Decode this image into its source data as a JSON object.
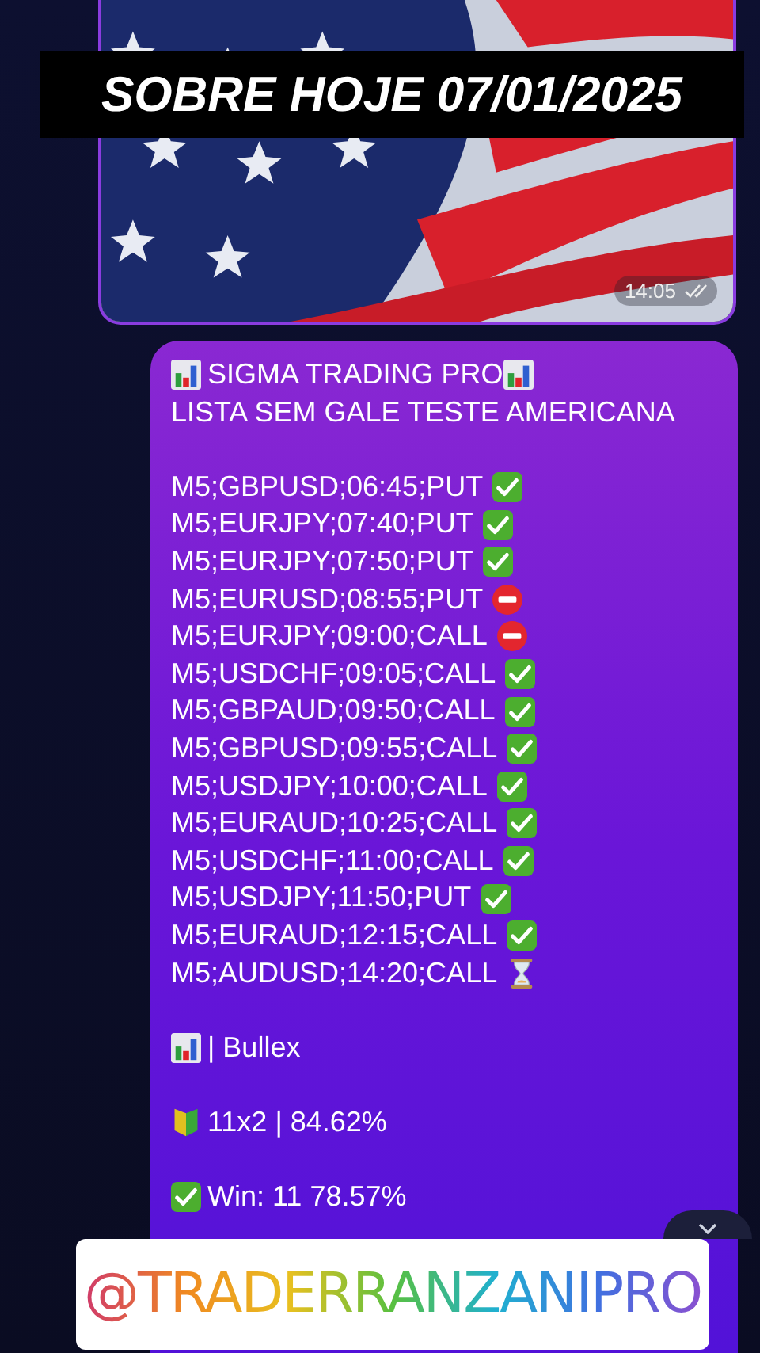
{
  "overlay_caption": "SOBRE HOJE 07/01/2025",
  "photo_message": {
    "kind": "picture",
    "time": "14:05",
    "read": true
  },
  "message": {
    "header": "SIGMA TRADING PRO",
    "subtitle": "LISTA SEM GALE TESTE AMERICANA",
    "signals": [
      {
        "text": "M5;GBPUSD;06:45;PUT",
        "kind": "win"
      },
      {
        "text": "M5;EURJPY;07:40;PUT",
        "kind": "win"
      },
      {
        "text": "M5;EURJPY;07:50;PUT",
        "kind": "win"
      },
      {
        "text": "M5;EURUSD;08:55;PUT",
        "kind": "loss"
      },
      {
        "text": "M5;EURJPY;09:00;CALL",
        "kind": "loss"
      },
      {
        "text": "M5;USDCHF;09:05;CALL",
        "kind": "win"
      },
      {
        "text": "M5;GBPAUD;09:50;CALL",
        "kind": "win"
      },
      {
        "text": "M5;GBPUSD;09:55;CALL",
        "kind": "win"
      },
      {
        "text": "M5;USDJPY;10:00;CALL",
        "kind": "win"
      },
      {
        "text": "M5;EURAUD;10:25;CALL",
        "kind": "win"
      },
      {
        "text": "M5;USDCHF;11:00;CALL",
        "kind": "win"
      },
      {
        "text": "M5;USDJPY;11:50;PUT",
        "kind": "win"
      },
      {
        "text": "M5;EURAUD;12:15;CALL",
        "kind": "win"
      },
      {
        "text": "M5;AUDUSD;14:20;CALL",
        "kind": "pending"
      }
    ],
    "broker": "| Bullex",
    "score": "11x2 | 84.62%",
    "win": "Win: 11 78.57%"
  },
  "watermark_handle": "@TRADERRANZANIPRO"
}
